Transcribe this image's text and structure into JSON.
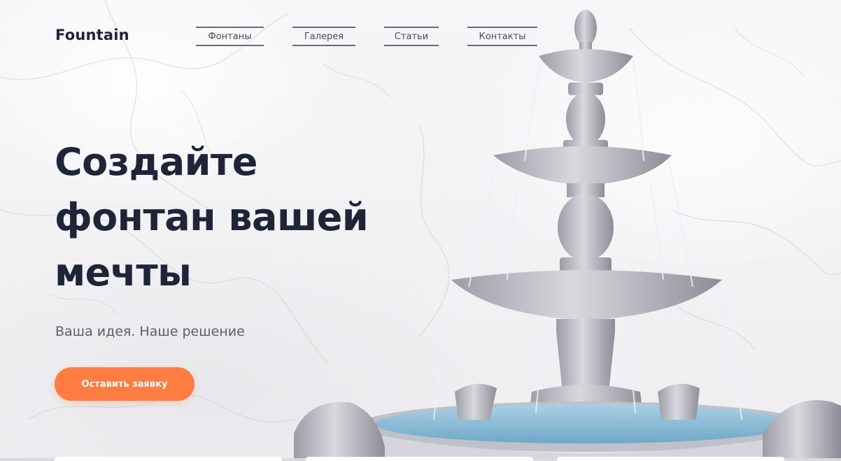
{
  "header": {
    "logo": "Fountain",
    "nav": [
      {
        "label": "Фонтаны"
      },
      {
        "label": "Галерея"
      },
      {
        "label": "Статьи"
      },
      {
        "label": "Контакты"
      }
    ]
  },
  "hero": {
    "title_lines": [
      "Создайте",
      "фонтан вашей",
      "мечты"
    ],
    "subtitle": "Ваша идея. Наше решение",
    "cta_label": "Оставить заявку"
  },
  "colors": {
    "accent": "#ff7c42",
    "heading": "#1f2438",
    "text": "#5d5d66",
    "nav_border": "#6a6a72"
  },
  "icons": {
    "hero_image": "fountain-image"
  }
}
